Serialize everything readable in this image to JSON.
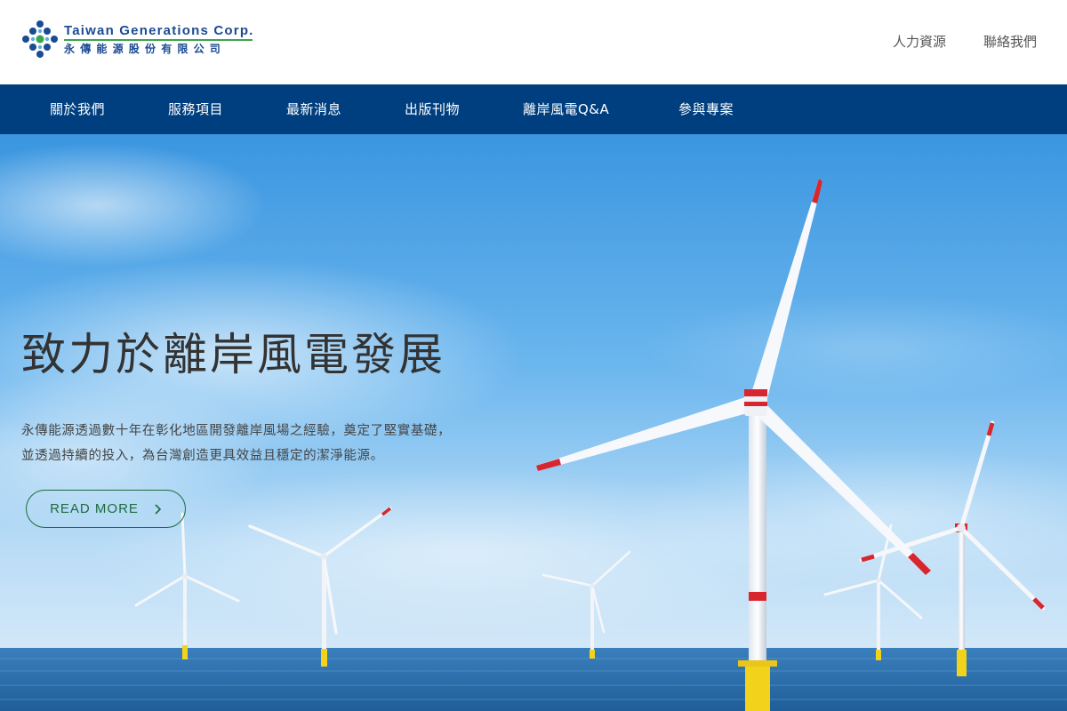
{
  "header": {
    "logo_en": "Taiwan Generations Corp.",
    "logo_zh": "永傳能源股份有限公司",
    "links": [
      {
        "label": "人力資源"
      },
      {
        "label": "聯絡我們"
      }
    ]
  },
  "nav": {
    "items": [
      {
        "label": "關於我們"
      },
      {
        "label": "服務項目"
      },
      {
        "label": "最新消息"
      },
      {
        "label": "出版刊物"
      },
      {
        "label": "離岸風電Q&A"
      },
      {
        "label": "參與專案"
      }
    ]
  },
  "hero": {
    "title": "致力於離岸風電發展",
    "description_lines": [
      "永傳能源透過數十年在彰化地區開發離岸風場之經驗，奠定了堅實基礎，",
      "並透過持續的投入，為台灣創造更具效益且穩定的潔淨能源。"
    ],
    "cta_label": "READ MORE",
    "cta_icon": "chevron-right-icon",
    "background": "offshore-wind-turbines-photo"
  },
  "colors": {
    "nav_bg": "#003f7f",
    "brand_blue": "#1b4b93",
    "brand_green": "#3aa54a",
    "cta_green": "#1d6b3e",
    "sky_top": "#3f9be3",
    "sea": "#2e6fa8",
    "turbine_red": "#d8262f",
    "turbine_yellow": "#f2d21b"
  }
}
